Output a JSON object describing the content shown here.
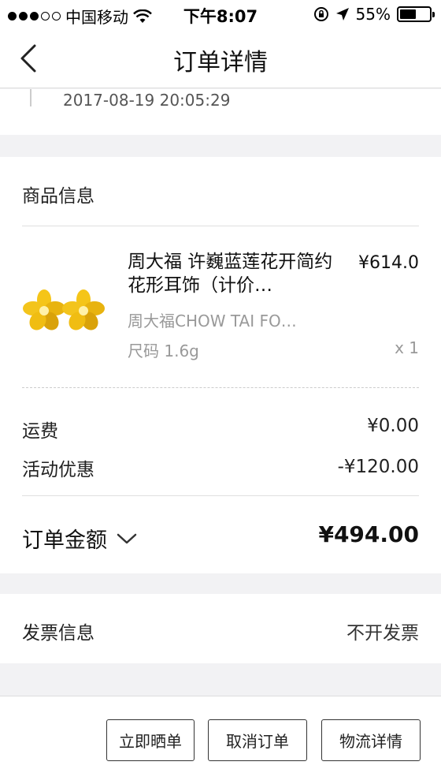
{
  "status_bar": {
    "carrier": "中国移动",
    "time": "下午8:07",
    "battery": "55%",
    "battery_level": 0.55
  },
  "nav": {
    "title": "订单详情",
    "back_icon": "chevron-left-icon"
  },
  "order": {
    "time": "2017-08-19 20:05:29"
  },
  "goods": {
    "section_title": "商品信息",
    "product": {
      "name": "周大福 许巍蓝莲花开简约花形耳饰（计价…",
      "price": "¥614.0",
      "brand": "周大福CHOW TAI FO…",
      "spec": "尺码  1.6g",
      "qty": "x 1",
      "image_icon": "gold-flower-earrings-image"
    }
  },
  "fees": {
    "shipping_label": "运费",
    "shipping_value": "¥0.00",
    "promo_label": "活动优惠",
    "promo_value": "-¥120.00",
    "total_label": "订单金额",
    "total_value": "¥494.00"
  },
  "invoice": {
    "label": "发票信息",
    "value": "不开发票"
  },
  "actions": {
    "share_label": "立即晒单",
    "cancel_label": "取消订单",
    "logistics_label": "物流详情"
  }
}
